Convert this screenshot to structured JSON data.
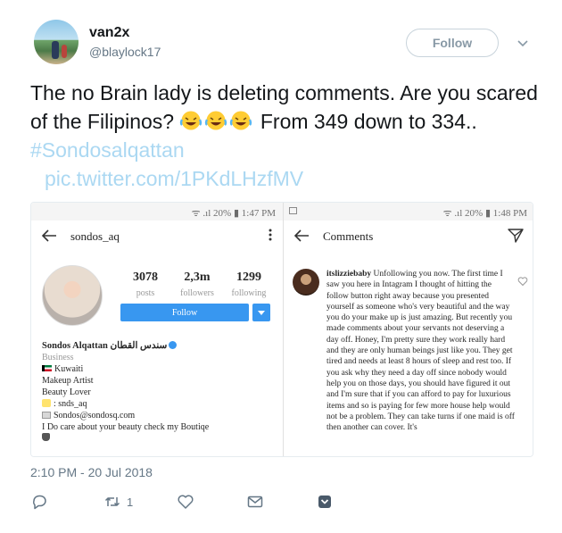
{
  "tweet": {
    "author": {
      "display_name": "van2x",
      "handle": "@blaylock17"
    },
    "follow_label": "Follow",
    "text_part1": "The no Brain lady  is deleting comments. Are you scared of the Filipinos?",
    "emoji": "face-with-tears-of-joy",
    "text_part2": "From 349 down to 334..",
    "hashtag": "#Sondosalqattan",
    "pic_link": "pic.twitter.com/1PKdLHzfMV",
    "timestamp": "2:10 PM - 20 Jul 2018",
    "retweet_count": "1"
  },
  "screenshot_left": {
    "status_time": "1:47 PM",
    "battery": "20%",
    "username": "sondos_aq",
    "stats": [
      {
        "num": "3078",
        "label": "posts"
      },
      {
        "num": "2,3m",
        "label": "followers"
      },
      {
        "num": "1299",
        "label": "following"
      }
    ],
    "follow_label": "Follow",
    "bio": {
      "name": "Sondos Alqattan سندس القطان",
      "category": "Business",
      "line1": "Kuwaiti",
      "line2": "Makeup Artist",
      "line3": "Beauty Lover",
      "snapchat": ": snds_aq",
      "email": "Sondos@sondosq.com",
      "line4": "I Do care about your beauty check my Boutiqe"
    }
  },
  "screenshot_right": {
    "status_time": "1:48 PM",
    "battery": "20%",
    "title": "Comments",
    "comment_user": "itslizziebaby",
    "comment_text": "Unfollowing you now. The first time I saw you here in Intagram I thought of hitting the follow button right away because you presented yourself as someone who's very beautiful and the way you do your make up is just amazing. But recently you made comments about your servants not deserving a day off. Honey, I'm pretty sure they work really hard and they are only human beings just like you. They get tired and needs at least 8 hours of sleep and rest too. If you ask why they need a day off since nobody would help you on those days, you should have figured it out and I'm sure that if you can afford to pay for luxurious items and so is paying for few more house help would not be a problem. They can take turns if one maid is off then another can cover. It's"
  },
  "colors": {
    "link": "#abd8f2",
    "ig_blue": "#3897f0",
    "muted": "#657786"
  }
}
